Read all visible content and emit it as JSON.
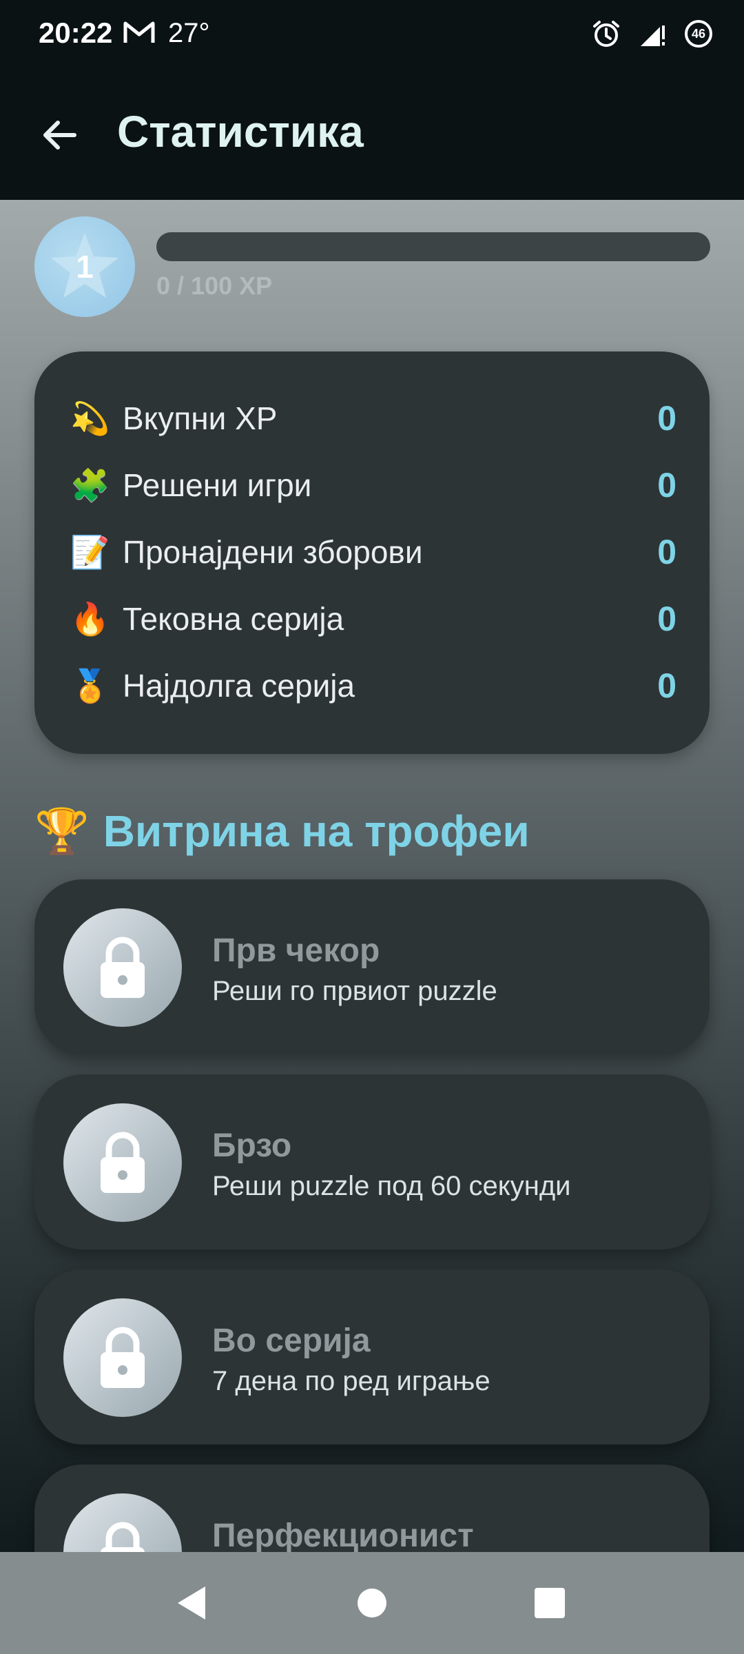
{
  "status_bar": {
    "time": "20:22",
    "temperature": "27°",
    "battery_level": "46",
    "icons": [
      "gmail-icon",
      "alarm-icon",
      "signal-icon",
      "battery-icon"
    ]
  },
  "app_bar": {
    "title": "Статистика",
    "back_icon": "arrow-left-icon"
  },
  "level": {
    "number": "1",
    "xp_text": "0 / 100 XP",
    "xp_progress": 0
  },
  "stats": [
    {
      "emoji": "💫",
      "label": "Вкупни XP",
      "value": "0"
    },
    {
      "emoji": "🧩",
      "label": "Решени игри",
      "value": "0"
    },
    {
      "emoji": "📝",
      "label": "Пронајдени зборови",
      "value": "0"
    },
    {
      "emoji": "🔥",
      "label": "Тековна серија",
      "value": "0"
    },
    {
      "emoji": "🏅",
      "label": "Најдолга серија",
      "value": "0"
    }
  ],
  "trophies": {
    "icon": "🏆",
    "title": "Витрина на трофеи",
    "items": [
      {
        "name": "Прв чекор",
        "description": "Реши го првиот puzzle",
        "locked": true
      },
      {
        "name": "Брзо",
        "description": "Реши puzzle под 60 секунди",
        "locked": true
      },
      {
        "name": "Во серија",
        "description": "7 дена по ред играње",
        "locked": true
      },
      {
        "name": "Перфекционист",
        "description": "",
        "locked": true
      }
    ]
  },
  "colors": {
    "accent": "#7fd3e6",
    "card": "#2d3436",
    "bar": "#0b1214"
  }
}
